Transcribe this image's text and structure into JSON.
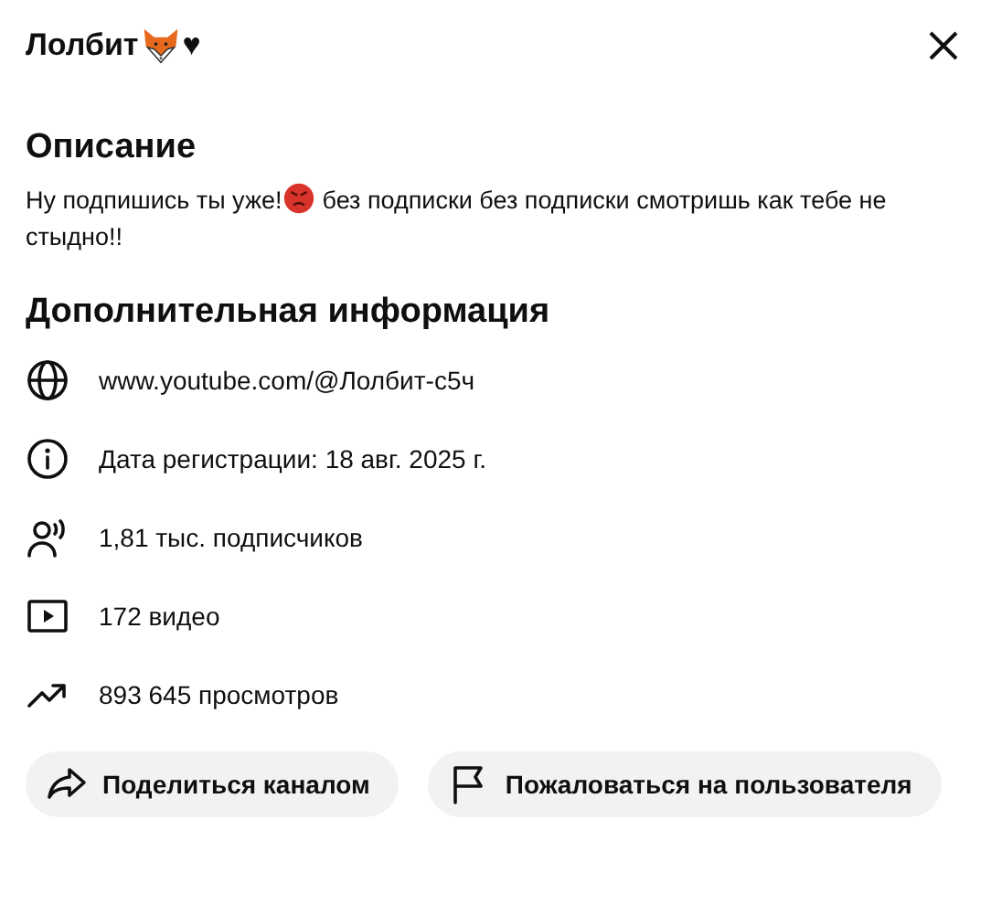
{
  "dialog": {
    "title": "Лолбит",
    "title_suffix": "♥"
  },
  "description": {
    "heading": "Описание",
    "text_before": "Ну подпишись ты уже!",
    "text_after": "без подписки без подписки смотришь как тебе не",
    "text_wrapped": "стыдно!!"
  },
  "details": {
    "heading": "Дополнительная информация",
    "rows": [
      {
        "kind": "link",
        "text": "www.youtube.com/@Лолбит-с5ч"
      },
      {
        "kind": "info",
        "text": "Дата регистрации: 18 авг. 2025 г."
      },
      {
        "kind": "subscribers",
        "text": "1,81 тыс. подписчиков"
      },
      {
        "kind": "videos",
        "text": "172 видео"
      },
      {
        "kind": "views",
        "text": "893 645 просмотров"
      }
    ]
  },
  "buttons": [
    {
      "kind": "share",
      "label": "Поделиться каналом"
    },
    {
      "kind": "report",
      "label": "Пожаловаться на пользователя"
    }
  ]
}
